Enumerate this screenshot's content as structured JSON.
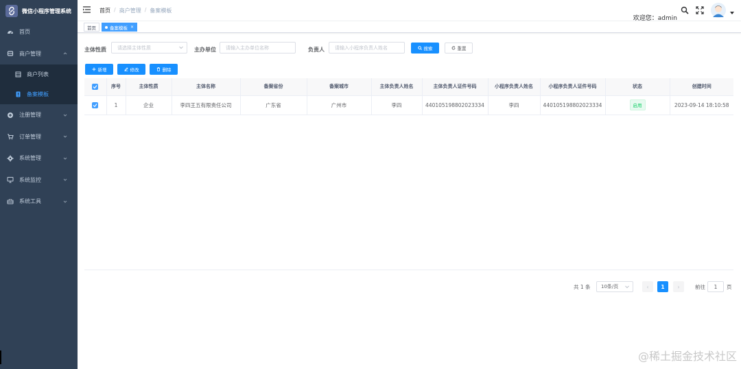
{
  "brand": {
    "title": "微信小程序管理系统",
    "logo_icon": "link-logo-icon"
  },
  "sidebar": {
    "items": [
      {
        "label": "首页",
        "icon": "dashboard-icon"
      },
      {
        "label": "商户管理",
        "icon": "shop-icon",
        "expanded": true
      },
      {
        "label": "注册管理",
        "icon": "register-icon"
      },
      {
        "label": "订单管理",
        "icon": "cart-icon"
      },
      {
        "label": "系统管理",
        "icon": "gear-icon"
      },
      {
        "label": "系统监控",
        "icon": "monitor-icon"
      },
      {
        "label": "系统工具",
        "icon": "tools-icon"
      }
    ],
    "subitems": [
      {
        "label": "商户列表",
        "icon": "list-icon",
        "active": false
      },
      {
        "label": "备案模板",
        "icon": "doc-icon",
        "active": true
      }
    ]
  },
  "header": {
    "breadcrumb": [
      "首页",
      "商户管理",
      "备案模板"
    ],
    "separator": "/",
    "welcome": "欢迎您：admin"
  },
  "tags": [
    {
      "label": "首页",
      "active": false
    },
    {
      "label": "备案模板",
      "active": true,
      "close": "×"
    }
  ],
  "search": {
    "subject_type_label": "主体性质",
    "subject_type_placeholder": "请选择主体性质",
    "organizer_label": "主办单位",
    "organizer_placeholder": "请输入主办单位名称",
    "owner_label": "负责人",
    "owner_placeholder": "请输入小程序负责人姓名",
    "search_button": "搜索",
    "reset_button": "重置"
  },
  "toolbar": {
    "add_button": "新增",
    "edit_button": "修改",
    "delete_button": "删除"
  },
  "table": {
    "columns": [
      "序号",
      "主体性质",
      "主体名称",
      "备案省份",
      "备案城市",
      "主体负责人姓名",
      "主体负责人证件号码",
      "小程序负责人姓名",
      "小程序负责人证件号码",
      "状态",
      "创建时间"
    ],
    "rows": [
      [
        "1",
        "企业",
        "李四王五有限责任公司",
        "广东省",
        "广州市",
        "李四",
        "440105198802023334",
        "李四",
        "440105198802023334",
        "启用",
        "2023-09-14 18:10:58"
      ]
    ]
  },
  "pagination": {
    "total": "共 1 条",
    "page_size": "10条/页",
    "current_page": "1",
    "goto_label": "前往",
    "goto_value": "1",
    "unit": "页",
    "prev": "‹",
    "next": "›"
  },
  "watermark": "@稀土掘金技术社区",
  "colors": {
    "sidebar_bg": "#304156",
    "primary": "#1890ff",
    "active_menu": "#409eff",
    "status_green": "#13ce66"
  }
}
